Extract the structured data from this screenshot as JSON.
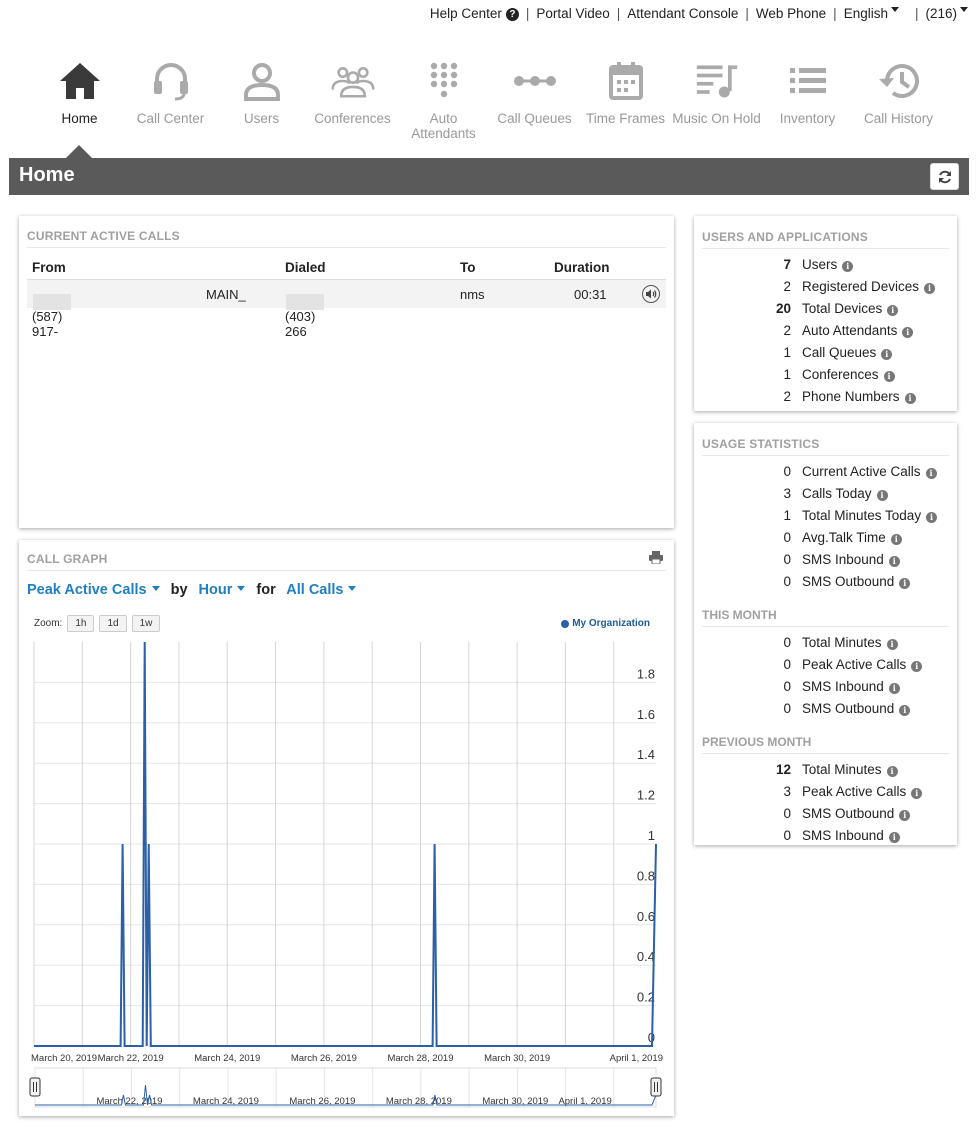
{
  "topbar": {
    "help_center": "Help Center",
    "portal_video": "Portal Video",
    "attendant_console": "Attendant Console",
    "web_phone": "Web Phone",
    "language": "English",
    "account": "(216)"
  },
  "nav": {
    "items": [
      {
        "label": "Home",
        "icon": "home-icon"
      },
      {
        "label": "Call Center",
        "icon": "headset-icon"
      },
      {
        "label": "Users",
        "icon": "user-icon"
      },
      {
        "label": "Conferences",
        "icon": "conference-icon"
      },
      {
        "label": "Auto Attendants",
        "icon": "keypad-icon"
      },
      {
        "label": "Call Queues",
        "icon": "queue-icon"
      },
      {
        "label": "Time Frames",
        "icon": "calendar-icon"
      },
      {
        "label": "Music On Hold",
        "icon": "music-icon"
      },
      {
        "label": "Inventory",
        "icon": "list-icon"
      },
      {
        "label": "Call History",
        "icon": "history-icon"
      }
    ]
  },
  "page": {
    "title": "Home"
  },
  "active_calls": {
    "title": "CURRENT ACTIVE CALLS",
    "headers": {
      "from": "From",
      "dialed": "Dialed",
      "to": "To",
      "duration": "Duration"
    },
    "rows": [
      {
        "from": "1 (587) 917-",
        "from_name": "MAIN_",
        "dialed": "1 (403) 266",
        "to": "nms",
        "duration": "00:31"
      }
    ]
  },
  "users_apps": {
    "title": "USERS AND APPLICATIONS",
    "items": [
      {
        "value": "7",
        "label": "Users",
        "bold": true
      },
      {
        "value": "2",
        "label": "Registered Devices",
        "bold": false
      },
      {
        "value": "20",
        "label": "Total Devices",
        "bold": true
      },
      {
        "value": "2",
        "label": "Auto Attendants",
        "bold": false
      },
      {
        "value": "1",
        "label": "Call Queues",
        "bold": false
      },
      {
        "value": "1",
        "label": "Conferences",
        "bold": false
      },
      {
        "value": "2",
        "label": "Phone Numbers",
        "bold": false
      }
    ]
  },
  "usage": {
    "title": "USAGE STATISTICS",
    "items": [
      {
        "value": "0",
        "label": "Current Active Calls",
        "bold": false
      },
      {
        "value": "3",
        "label": "Calls Today",
        "bold": false
      },
      {
        "value": "1",
        "label": "Total Minutes Today",
        "bold": false
      },
      {
        "value": "0",
        "label": "Avg.Talk Time",
        "bold": false
      },
      {
        "value": "0",
        "label": "SMS Inbound",
        "bold": false
      },
      {
        "value": "0",
        "label": "SMS Outbound",
        "bold": false
      }
    ],
    "this_month_title": "THIS MONTH",
    "this_month": [
      {
        "value": "0",
        "label": "Total Minutes",
        "bold": false
      },
      {
        "value": "0",
        "label": "Peak Active Calls",
        "bold": false
      },
      {
        "value": "0",
        "label": "SMS Inbound",
        "bold": false
      },
      {
        "value": "0",
        "label": "SMS Outbound",
        "bold": false
      }
    ],
    "prev_month_title": "PREVIOUS MONTH",
    "prev_month": [
      {
        "value": "12",
        "label": "Total Minutes",
        "bold": true
      },
      {
        "value": "3",
        "label": "Peak Active Calls",
        "bold": false
      },
      {
        "value": "0",
        "label": "SMS Outbound",
        "bold": false
      },
      {
        "value": "0",
        "label": "SMS Inbound",
        "bold": false
      }
    ]
  },
  "call_graph": {
    "title": "CALL GRAPH",
    "metric": "Peak Active Calls",
    "by_label": "by",
    "interval": "Hour",
    "for_label": "for",
    "filter": "All Calls",
    "zoom_label": "Zoom:",
    "zoom_options": [
      "1h",
      "1d",
      "1w"
    ]
  },
  "chart_data": {
    "type": "line",
    "series": [
      {
        "name": "My Organization",
        "color": "#2b5fa8",
        "points": [
          {
            "x": "2019-03-20T00:00",
            "y": 0
          },
          {
            "x": "2019-03-21T19:00",
            "y": 0
          },
          {
            "x": "2019-03-21T20:00",
            "y": 1
          },
          {
            "x": "2019-03-21T21:00",
            "y": 0
          },
          {
            "x": "2019-03-22T06:00",
            "y": 0
          },
          {
            "x": "2019-03-22T07:00",
            "y": 2
          },
          {
            "x": "2019-03-22T08:00",
            "y": 0
          },
          {
            "x": "2019-03-22T09:00",
            "y": 1
          },
          {
            "x": "2019-03-22T10:00",
            "y": 0
          },
          {
            "x": "2019-03-28T06:00",
            "y": 0
          },
          {
            "x": "2019-03-28T07:00",
            "y": 1
          },
          {
            "x": "2019-03-28T08:00",
            "y": 0
          },
          {
            "x": "2019-04-01T19:00",
            "y": 0
          },
          {
            "x": "2019-04-01T21:00",
            "y": 1
          }
        ]
      }
    ],
    "x_ticks": [
      "March 20, 2019",
      "March 22, 2019",
      "March 24, 2019",
      "March 26, 2019",
      "March 28, 2019",
      "March 30, 2019",
      "April 1, 2019"
    ],
    "navigator_ticks": [
      "March 22, 2019",
      "March 24, 2019",
      "March 26, 2019",
      "March 28, 2019",
      "March 30, 2019",
      "April 1, 2019"
    ],
    "y_ticks": [
      "0",
      "0.2",
      "0.4",
      "0.6",
      "0.8",
      "1",
      "1.2",
      "1.4",
      "1.6",
      "1.8"
    ],
    "ylim": [
      0,
      2
    ],
    "xlim": [
      "2019-03-20T00:00",
      "2019-04-01T21:00"
    ],
    "legend": "top-right",
    "grid": true
  }
}
